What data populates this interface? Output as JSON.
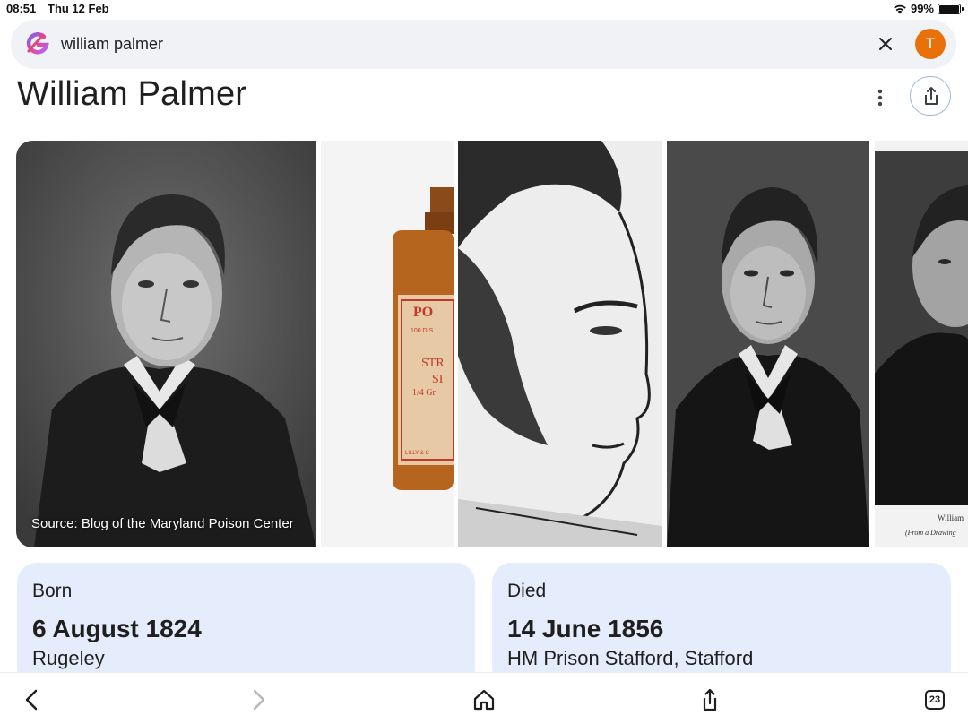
{
  "status_bar": {
    "time": "08:51",
    "date": "Thu 12 Feb",
    "battery": "99%",
    "battery_level": 0.99
  },
  "search": {
    "query": "william palmer",
    "avatar_initial": "T",
    "avatar_color": "#e8710a"
  },
  "page": {
    "title": "William Palmer"
  },
  "images": {
    "first_caption": "Source: Blog of the Maryland Poison Center",
    "bottle_label": "PO",
    "bottle_line2": "100 DIS",
    "bottle_line3": "STR",
    "bottle_line4": "SI",
    "bottle_line5": "1/4 Gr",
    "bottle_line6": "LILLY & C",
    "last_caption_1": "William",
    "last_caption_2": "(From a Drawing"
  },
  "born": {
    "label": "Born",
    "date": "6 August 1824",
    "place": "Rugeley"
  },
  "died": {
    "label": "Died",
    "date": "14 June 1856",
    "place": "HM Prison Stafford, Stafford"
  },
  "toolbar": {
    "tab_count": "23"
  },
  "colors": {
    "card_bg": "#e5edfc",
    "accent": "#e8710a"
  }
}
